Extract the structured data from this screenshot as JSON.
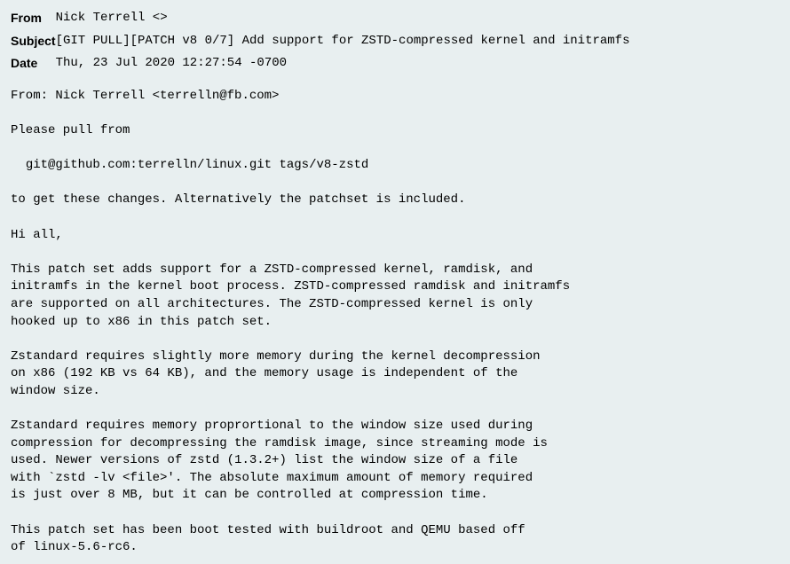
{
  "header": {
    "from_label": "From",
    "from_value": "Nick Terrell <>",
    "subject_label": "Subject",
    "subject_value": "[GIT PULL][PATCH v8 0/7] Add support for ZSTD-compressed kernel and initramfs",
    "date_label": "Date",
    "date_value": "Thu, 23 Jul 2020 12:27:54 -0700"
  },
  "body": "From: Nick Terrell <terrelln@fb.com>\n\nPlease pull from\n\n  git@github.com:terrelln/linux.git tags/v8-zstd\n\nto get these changes. Alternatively the patchset is included.\n\nHi all,\n\nThis patch set adds support for a ZSTD-compressed kernel, ramdisk, and\ninitramfs in the kernel boot process. ZSTD-compressed ramdisk and initramfs\nare supported on all architectures. The ZSTD-compressed kernel is only\nhooked up to x86 in this patch set.\n\nZstandard requires slightly more memory during the kernel decompression\non x86 (192 KB vs 64 KB), and the memory usage is independent of the\nwindow size.\n\nZstandard requires memory proprortional to the window size used during\ncompression for decompressing the ramdisk image, since streaming mode is\nused. Newer versions of zstd (1.3.2+) list the window size of a file\nwith `zstd -lv <file>'. The absolute maximum amount of memory required\nis just over 8 MB, but it can be controlled at compression time.\n\nThis patch set has been boot tested with buildroot and QEMU based off\nof linux-5.6-rc6."
}
